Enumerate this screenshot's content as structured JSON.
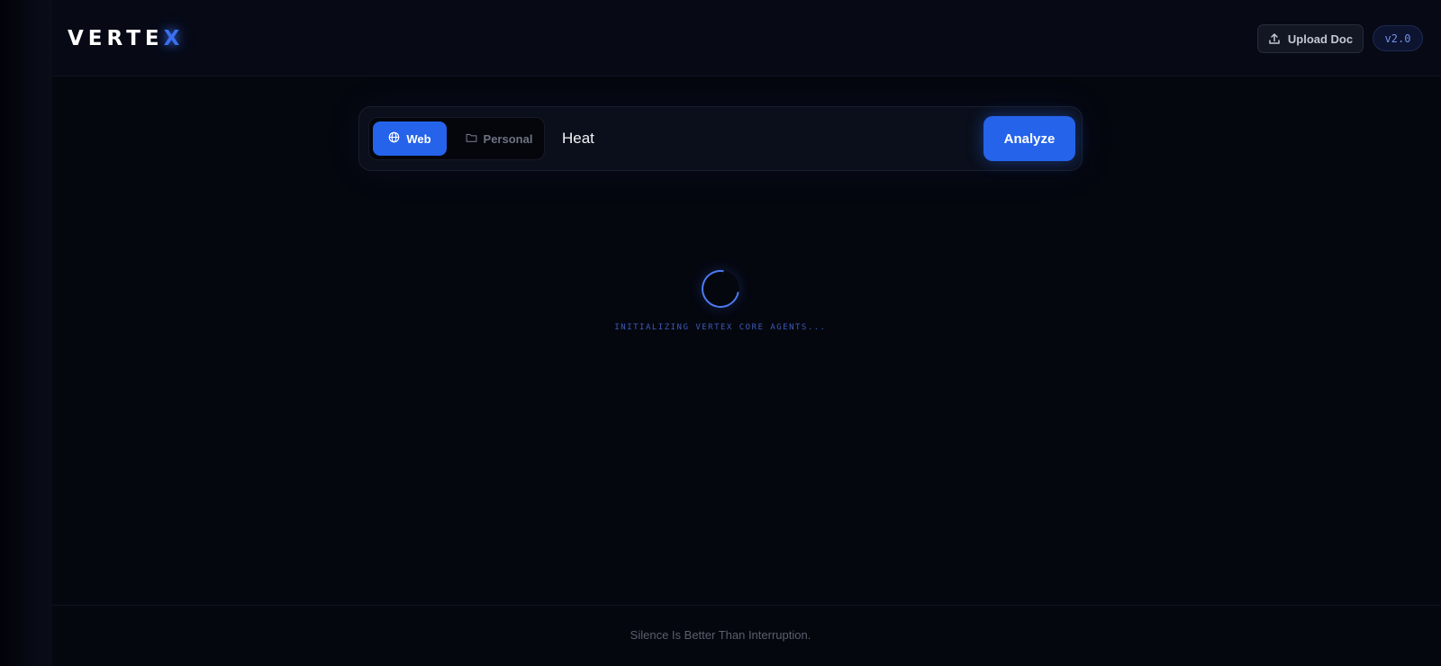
{
  "header": {
    "logo_main": "VERTE",
    "logo_accent": "X",
    "upload_label": "Upload Doc",
    "upload_icon": "upload-icon",
    "version": "v2.0"
  },
  "search": {
    "modes": [
      {
        "label": "Web",
        "icon": "globe-icon",
        "active": true
      },
      {
        "label": "Personal",
        "icon": "folder-icon",
        "active": false
      }
    ],
    "query_value": "Heat",
    "analyze_label": "Analyze"
  },
  "status": {
    "loading_text": "INITIALIZING VERTEX CORE AGENTS..."
  },
  "footer": {
    "tagline": "Silence Is Better Than Interruption."
  },
  "colors": {
    "accent": "#2563eb",
    "background": "#05070f"
  }
}
